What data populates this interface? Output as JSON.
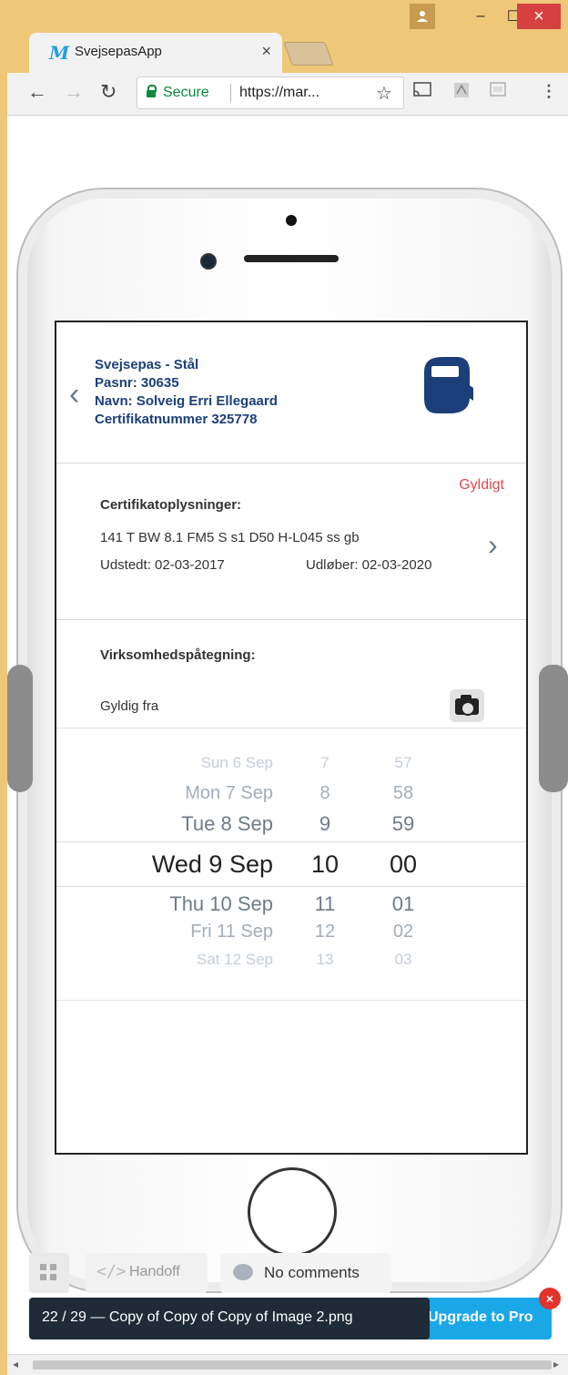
{
  "browser": {
    "tab_title": "SvejsepasApp",
    "tab_logo": "M",
    "tab_close": "×",
    "window_min": "–",
    "window_max": "☐",
    "window_close": "×",
    "secure_label": "Secure",
    "url": "https://mar...",
    "star": "☆"
  },
  "app": {
    "header": {
      "title": "Svejsepas - Stål",
      "passport": "Pasnr: 30635",
      "name": "Navn: Solveig Erri Ellegaard",
      "certificate": "Certifikatnummer 325778"
    },
    "certificate": {
      "status": "Gyldigt",
      "title": "Certifikatoplysninger:",
      "code": "141 T BW 8.1 FM5 S s1 D50 H-L045 ss gb",
      "issued": "Udstedt: 02-03-2017",
      "expires": "Udløber: 02-03-2020"
    },
    "endorsement": {
      "title": "Virksomhedspåtegning:",
      "valid_from_label": "Gyldig fra"
    },
    "picker": {
      "rows": [
        {
          "date": "Sun 6 Sep",
          "hour": "7",
          "minute": "57"
        },
        {
          "date": "Mon 7 Sep",
          "hour": "8",
          "minute": "58"
        },
        {
          "date": "Tue 8 Sep",
          "hour": "9",
          "minute": "59"
        },
        {
          "date": "Wed 9 Sep",
          "hour": "10",
          "minute": "00"
        },
        {
          "date": "Thu 10 Sep",
          "hour": "11",
          "minute": "01"
        },
        {
          "date": "Fri 11 Sep",
          "hour": "12",
          "minute": "02"
        },
        {
          "date": "Sat 12 Sep",
          "hour": "13",
          "minute": "03"
        }
      ],
      "selected_index": 3
    }
  },
  "viewer": {
    "handoff_label": "Handoff",
    "handoff_icon": "</>",
    "comments_label": "No comments",
    "file_info": "22 / 29 — Copy of Copy of Copy of Image 2.png",
    "upgrade_label": "Upgrade to Pro",
    "close_badge": "×"
  },
  "colors": {
    "window_frame": "#eec878",
    "app_blue": "#1c3f7a",
    "status_red": "#e04a4a",
    "upgrade_blue": "#1aa7e8"
  }
}
